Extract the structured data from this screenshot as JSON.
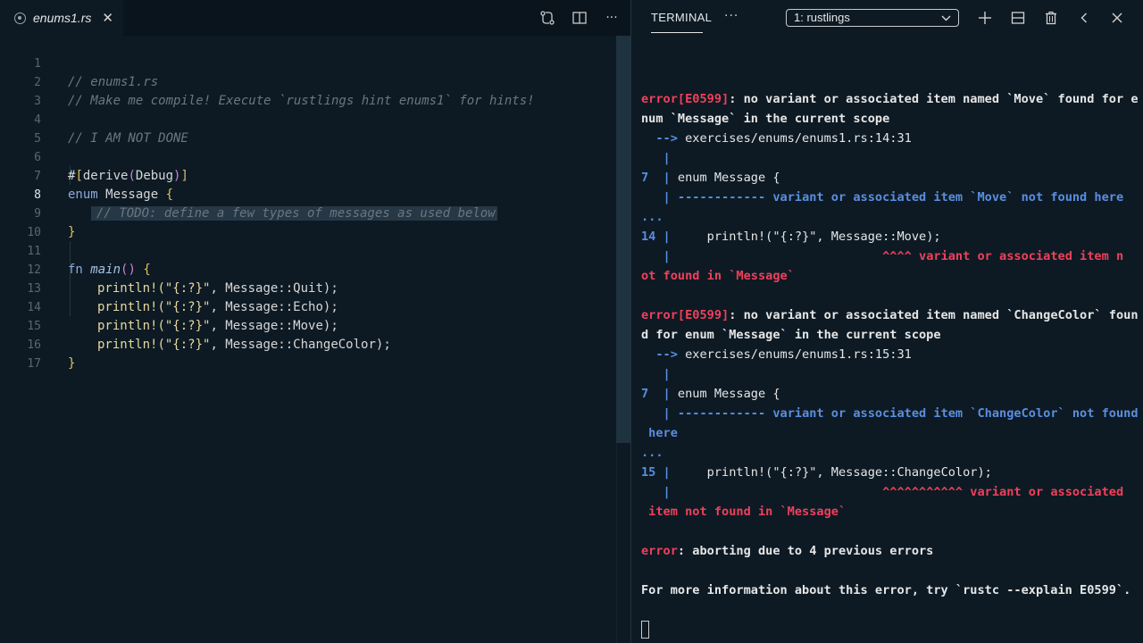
{
  "editor": {
    "tab": {
      "title": "enums1.rs",
      "icon": "rust-file-icon",
      "close": "✕"
    },
    "actions": [
      "source-control-icon",
      "split-editor-icon",
      "more-icon"
    ],
    "more_glyph": "···",
    "active_line": 8,
    "line_numbers": [
      "1",
      "2",
      "3",
      "4",
      "5",
      "6",
      "7",
      "8",
      "9",
      "10",
      "11",
      "12",
      "13",
      "14",
      "15",
      "16",
      "17"
    ],
    "lines": {
      "l1": "// enums1.rs",
      "l2": "// Make me compile! Execute `rustlings hint enums1` for hints!",
      "l4": "// I AM NOT DONE",
      "l6_hash": "#",
      "l6_open": "[",
      "l6_derive": "derive",
      "l6_paren_open": "(",
      "l6_debug": "Debug",
      "l6_paren_close": ")",
      "l6_close": "]",
      "l7_kw": "enum",
      "l7_name": " Message ",
      "l7_brace": "{",
      "l8_todo": "// TODO: define a few types of messages as used below",
      "l9_brace": "}",
      "l11_kw": "fn",
      "l11_fn": "main",
      "l11_parens": "()",
      "l11_brace": "{",
      "l12_mac": "println!",
      "l12_str": "(\"{:?}\"",
      "l12_rest": ", Message::Quit);",
      "l13_mac": "println!",
      "l13_str": "(\"{:?}\"",
      "l13_rest": ", Message::Echo);",
      "l14_mac": "println!",
      "l14_str": "(\"{:?}\"",
      "l14_rest": ", Message::Move);",
      "l15_mac": "println!",
      "l15_str": "(\"{:?}\"",
      "l15_rest": ", Message::ChangeColor);",
      "l16_brace": "}"
    }
  },
  "terminal": {
    "tab_label": "TERMINAL",
    "more_glyph": "···",
    "selected_shell": "1: rustlings",
    "actions": [
      "new-terminal-icon",
      "split-terminal-icon",
      "trash-icon",
      "chevron-left-icon",
      "close-icon"
    ],
    "output": {
      "e1_code": "error[E0599]",
      "e1_msg_a": ": no variant or associated item named `Move` found for e",
      "e1_msg_b": "num `Message` in the current scope",
      "e1_arrow": "  --> ",
      "e1_path": "exercises/enums/enums1.rs:14:31",
      "e1_pipe1": "   |",
      "e1_l7_num": "7  |",
      "e1_l7_code": " enum Message {",
      "e1_under_pipe": "   |",
      "e1_under": " ------------ variant or associated item `Move` not found here",
      "e1_dots": "...",
      "e1_l14_num": "14 |",
      "e1_l14_code": "     println!(\"{:?}\", Message::Move);",
      "e1_caret_pipe": "   |",
      "e1_caret": "                             ^^^^ variant or associated item n",
      "e1_caret_b": "ot found in `Message`",
      "e2_code": "error[E0599]",
      "e2_msg_a": ": no variant or associated item named `ChangeColor` foun",
      "e2_msg_b": "d for enum `Message` in the current scope",
      "e2_arrow": "  --> ",
      "e2_path": "exercises/enums/enums1.rs:15:31",
      "e2_pipe1": "   |",
      "e2_l7_num": "7  |",
      "e2_l7_code": " enum Message {",
      "e2_under_pipe": "   |",
      "e2_under": " ------------ variant or associated item `ChangeColor` not found",
      "e2_under_b": " here",
      "e2_dots": "...",
      "e2_l15_num": "15 |",
      "e2_l15_code": "     println!(\"{:?}\", Message::ChangeColor);",
      "e2_caret_pipe": "   |",
      "e2_caret": "                             ^^^^^^^^^^^ variant or associated",
      "e2_caret_b": " item not found in `Message`",
      "abort_label": "error",
      "abort_msg": ": aborting due to 4 previous errors",
      "info": "For more information about this error, try `rustc --explain E0599`."
    }
  }
}
